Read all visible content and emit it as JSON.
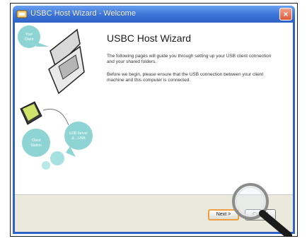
{
  "window": {
    "title": "USBC Host Wizard - Welcome",
    "close_symbol": "×",
    "accent_color": "#3b74d8"
  },
  "side_panel": {
    "bubbles": [
      "Your Client",
      "Client Station",
      "USB Server & ...USB"
    ],
    "icons": [
      "laptop-icon",
      "tablet-icon"
    ]
  },
  "main": {
    "heading": "USBC Host Wizard",
    "paragraph_1": "The following pages will guide you through setting up your USB client connection and your shared folders.",
    "paragraph_2": "Before we begin, please ensure that the USB connection between your client machine and this computer is connected."
  },
  "footer": {
    "next_label": "Next >",
    "cancel_label": "Cancel"
  }
}
